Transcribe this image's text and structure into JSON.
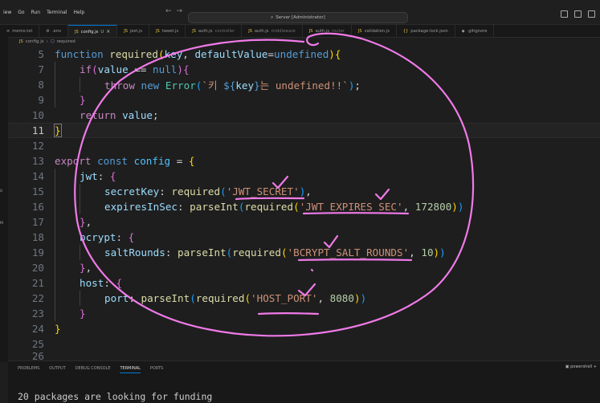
{
  "menu": [
    "iew",
    "Go",
    "Run",
    "Terminal",
    "Help"
  ],
  "command_center": {
    "text": "Server [Administrator]"
  },
  "tabs": [
    {
      "name": "memo.txt",
      "icon": "≡",
      "icon_color": "#9d9d9d",
      "desc": ""
    },
    {
      "name": ".env",
      "icon": "⚙",
      "icon_color": "#9d9d9d",
      "desc": ""
    },
    {
      "name": "config.js",
      "icon": "JS",
      "icon_color": "#e8c44a",
      "desc": "",
      "badge": "U",
      "active": true
    },
    {
      "name": "jest.js",
      "icon": "JS",
      "icon_color": "#e8c44a",
      "desc": ""
    },
    {
      "name": "tweet.js",
      "icon": "JS",
      "icon_color": "#e8c44a",
      "desc": ""
    },
    {
      "name": "auth.js",
      "icon": "JS",
      "icon_color": "#e8c44a",
      "desc": "controller"
    },
    {
      "name": "auth.js",
      "icon": "JS",
      "icon_color": "#e8c44a",
      "desc": "middleware"
    },
    {
      "name": "auth.js",
      "icon": "JS",
      "icon_color": "#e8c44a",
      "desc": "router"
    },
    {
      "name": "validation.js",
      "icon": "JS",
      "icon_color": "#e8c44a",
      "desc": ""
    },
    {
      "name": "package-lock.json",
      "icon": "{}",
      "icon_color": "#e8c44a",
      "desc": ""
    },
    {
      "name": ".gitignore",
      "icon": "◆",
      "icon_color": "#9d9d9d",
      "desc": ""
    }
  ],
  "breadcrumb": {
    "file": "config.js",
    "symbol": "required"
  },
  "left_badges": [
    "U",
    "M"
  ],
  "line_numbers": [
    "5",
    "7",
    "8",
    "9",
    "10",
    "11",
    "12",
    "13",
    "14",
    "15",
    "16",
    "17",
    "18",
    "19",
    "20",
    "21",
    "22",
    "23",
    "24",
    "25",
    "26"
  ],
  "code": {
    "l5": {
      "kw": "function",
      "fn": "required",
      "p1": "(",
      "a1": "key",
      "c1": ", ",
      "a2": "defaultValue",
      "eq": "=",
      "k2": "undefined",
      "p2": ")",
      "b": "{"
    },
    "l7": {
      "kw": "if",
      "p1": "(",
      "v": "value",
      "op": " == ",
      "k": "null",
      "p2": ")",
      "b": "{"
    },
    "l8": {
      "kw": "throw",
      "kw2": "new",
      "cls": "Error",
      "p1": "(",
      "s1": "`키 ",
      "i1": "${",
      "iv": "key",
      "i2": "}",
      "s2": "는 undefined!!`",
      "p2": ")",
      "end": ";"
    },
    "l9": {
      "b": "}"
    },
    "l10": {
      "kw": "return",
      "v": "value",
      "end": ";"
    },
    "l11": {
      "b": "}"
    },
    "l13": {
      "kw": "export",
      "kw2": "const",
      "v": "config",
      "eq": " = ",
      "b": "{"
    },
    "l14": {
      "prop": "jwt",
      "c": ": ",
      "b": "{"
    },
    "l15": {
      "prop": "secretKey",
      "c": ": ",
      "fn": "required",
      "p1": "(",
      "s": "'JWT_SECRET'",
      "p2": ")",
      "end": ","
    },
    "l16": {
      "prop": "expiresInSec",
      "c": ": ",
      "fn": "parseInt",
      "p1": "(",
      "fn2": "required",
      "p3": "(",
      "s": "'JWT_EXPIRES_SEC'",
      "cm": ", ",
      "n": "172800",
      "p4": ")",
      "p2": ")"
    },
    "l17": {
      "b": "}",
      "end": ","
    },
    "l18": {
      "prop": "bcrypt",
      "c": ": ",
      "b": "{"
    },
    "l19": {
      "prop": "saltRounds",
      "c": ": ",
      "fn": "parseInt",
      "p1": "(",
      "fn2": "required",
      "p3": "(",
      "s": "'BCRYPT_SALT_ROUNDS'",
      "cm": ", ",
      "n": "10",
      "p4": ")",
      "p2": ")"
    },
    "l20": {
      "b": "}",
      "end": ","
    },
    "l21": {
      "prop": "host",
      "c": ": ",
      "b": "{"
    },
    "l22": {
      "prop": "port",
      "c": ": ",
      "fn": "parseInt",
      "p1": "(",
      "fn2": "required",
      "p3": "(",
      "s": "'HOST_PORT'",
      "cm": ", ",
      "n": "8080",
      "p4": ")",
      "p2": ")"
    },
    "l23": {
      "b": "}"
    },
    "l24": {
      "b": "}"
    }
  },
  "panel": {
    "tabs": [
      "PROBLEMS",
      "OUTPUT",
      "DEBUG CONSOLE",
      "TERMINAL",
      "PORTS"
    ],
    "shell": "powershell",
    "terminal_line": "20 packages are looking for funding"
  },
  "colors": {
    "annotation": "#f07ae8",
    "accent": "#0078d4"
  }
}
